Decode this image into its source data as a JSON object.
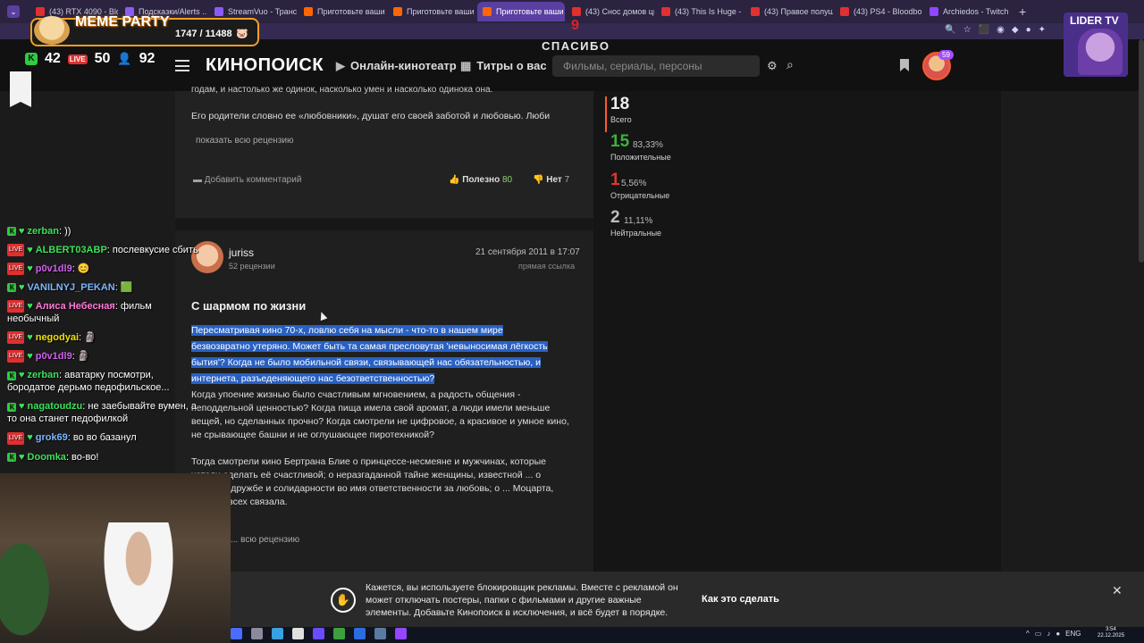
{
  "browser": {
    "tabs": [
      {
        "label": "(43) RTX 4090 - Bloodb...",
        "icon": "youtube-icon"
      },
      {
        "label": "Подсказки/Alerts ...",
        "icon": "stream-icon"
      },
      {
        "label": "StreamVuo - Трансляции",
        "icon": "streamvuo-icon"
      },
      {
        "label": "Приготовьте ваши носо...",
        "icon": "kinopoisk-icon"
      },
      {
        "label": "Приготовьте ваши н...",
        "icon": "kinopoisk-icon"
      },
      {
        "label": "Приготовьте ваши носо...",
        "icon": "kinopoisk-icon",
        "active": true
      },
      {
        "label": "(43) Снос домов цыган г...",
        "icon": "youtube-icon"
      },
      {
        "label": "(43) This Is Huge - YouTu...",
        "icon": "youtube-icon"
      },
      {
        "label": "(43) Правое полушарие ...",
        "icon": "youtube-icon"
      },
      {
        "label": "(43) PS4 - Bloodborne Ga...",
        "icon": "youtube-icon"
      },
      {
        "label": "Archiedos - Twitch",
        "icon": "twitch-icon"
      }
    ]
  },
  "kinopoisk": {
    "logo": "КИНОПОИСК",
    "nav": [
      "Онлайн-кинотеатр",
      "Титры о вас"
    ],
    "search_placeholder": "Фильмы, сериалы, персоны",
    "notif_count": "59",
    "spasibo": "СПАСИБО",
    "stream_number": "9"
  },
  "review1": {
    "cut_line": "годам, и настолько же одинок, насколько умен и насколько одинока она.",
    "paragraph": "Его родители словно ее «любовники», душат его своей заботой и любовью. Люби",
    "show_full": "показать всю рецензию",
    "add_comment": "Добавить комментарий",
    "useful_label": "Полезно",
    "useful_count": "80",
    "no_label": "Нет",
    "no_count": "7"
  },
  "review2": {
    "author": "juriss",
    "author_reviews": "52 рецензии",
    "date": "21 сентября 2011 в 17:07",
    "direct_link": "прямая ссылка",
    "title": "С шармом по жизни",
    "highlighted": [
      "Пересматривая кино 70-х, ловлю себя на мысли - что-то в нашем мире",
      "безвозвратно утеряно. Может быть та самая пресловутая 'невыносимая лёгкость",
      "бытия'? Когда не было мобильной связи, связывающей нас обязательностью, и",
      "интернета, разъеденяющего нас безответственностью?"
    ],
    "paragraph2": "Когда упоение жизнью было счастливым мгновением, а радость общения - неподдельной ценностью? Когда пища имела свой аромат, а люди имели меньше вещей, но сделанных прочно? Когда смотрели не цифровое, а красивое и умное кино, не срывающее башни и не оглушающее пиротехникой?",
    "paragraph3": "Тогда смотрели кино Бертрана Блие о принцессе-несмеяне и мужчинах, которые хотели сделать её счастливой; о неразгаданной тайне женщины, известной ... о мужской дружбе и солидарности во имя ответственности за любовь; о ... Моцарта, которая всех связала.",
    "show_full": "... всю рецензию"
  },
  "stats": {
    "total": "18",
    "total_label": "Всего",
    "positive": "15",
    "positive_pct": "83,33%",
    "positive_label": "Положительные",
    "negative": "1",
    "negative_pct": "5,56%",
    "negative_label": "Отрицательные",
    "neutral": "2",
    "neutral_pct": "11,11%",
    "neutral_label": "Нейтральные",
    "colors": {
      "positive": "#3bb33b",
      "negative": "#e03535",
      "neutral": "#bdbdbd"
    }
  },
  "overlay": {
    "meme_title": "MEME PARTY",
    "meme_count": "1747 / 11488",
    "kick_viewers": "42",
    "vk_viewers": "50",
    "users": "92",
    "lider": "LIDER TV"
  },
  "chat": [
    {
      "nick": "zerban",
      "color": "#3ce25a",
      "badge": "k",
      "text": " ))"
    },
    {
      "nick": "ALBERT03ABP",
      "color": "#3ce25a",
      "badge": "v",
      "text": " послевкусие сбить"
    },
    {
      "nick": "p0v1dl9",
      "color": "#d15ef0",
      "badge": "v",
      "text": " 😊"
    },
    {
      "nick": "VANILNYJ_PEKAN",
      "color": "#7db6ff",
      "badge": "k",
      "text": " 🟩"
    },
    {
      "nick": "Алиса Небесная",
      "color": "#ff7ad9",
      "badge": "v",
      "text": " фильм необычный"
    },
    {
      "nick": "negodyai",
      "color": "#f0e000",
      "badge": "v",
      "text": " 🗿"
    },
    {
      "nick": "p0v1dl9",
      "color": "#d15ef0",
      "badge": "v",
      "text": " 🗿"
    },
    {
      "nick": "zerban",
      "color": "#3ce25a",
      "badge": "k",
      "text": " аватарку посмотри, бородатое дерьмо педофильское..."
    },
    {
      "nick": "nagatoudzu",
      "color": "#3ce25a",
      "badge": "k",
      "text": " не заебывайте вумен, а то она станет педофилкой"
    },
    {
      "nick": "grok69",
      "color": "#7db6ff",
      "badge": "v",
      "text": " во во базанул"
    },
    {
      "nick": "Doomka",
      "color": "#3ce25a",
      "badge": "k",
      "text": " во-во!"
    }
  ],
  "adblock": {
    "text": "Кажется, вы используете блокировщик рекламы. Вместе с рекламой он может отключать постеры, папки с фильмами и другие важные элементы. Добавьте Кинопоиск в исключения, и всё будет в порядке.",
    "how": "Как это сделать"
  },
  "taskbar": {
    "lang": "ENG",
    "time": "3:54",
    "date": "22.12.2025"
  }
}
